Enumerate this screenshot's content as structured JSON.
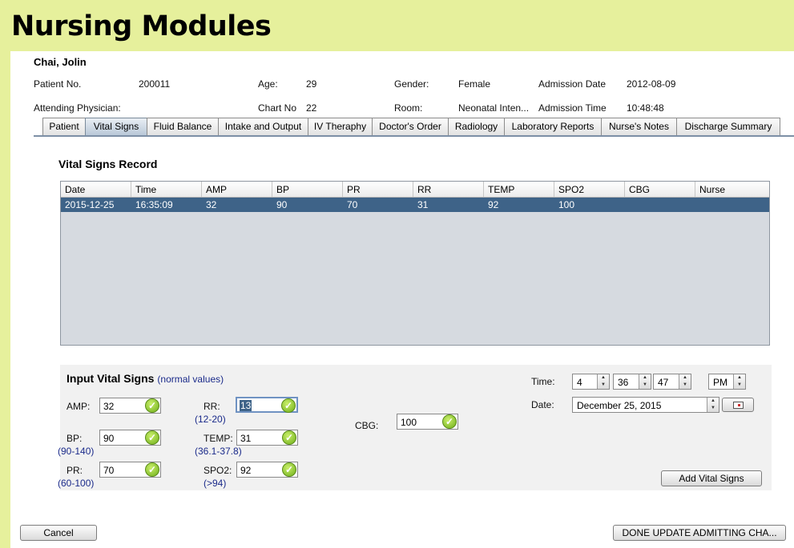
{
  "app_title": "Nursing Modules",
  "patient": {
    "name": "Chai, Jolin",
    "fields": {
      "patient_no_label": "Patient No.",
      "patient_no": "200011",
      "age_label": "Age:",
      "age": "29",
      "gender_label": "Gender:",
      "gender": "Female",
      "admission_date_label": "Admission Date",
      "admission_date": "2012-08-09",
      "physician_label": "Attending Physician:",
      "physician": "",
      "chart_no_label": "Chart No",
      "chart_no": "22",
      "room_label": "Room:",
      "room": "Neonatal Inten...",
      "admission_time_label": "Admission Time",
      "admission_time": "10:48:48"
    }
  },
  "tabs": [
    "Patient",
    "Vital Signs",
    "Fluid Balance",
    "Intake and Output",
    "IV Theraphy",
    "Doctor's Order",
    "Radiology",
    "Laboratory Reports",
    "Nurse's Notes",
    "Discharge Summary"
  ],
  "active_tab": "Vital Signs",
  "record": {
    "title": "Vital Signs Record",
    "columns": [
      "Date",
      "Time",
      "AMP",
      "BP",
      "PR",
      "RR",
      "TEMP",
      "SPO2",
      "CBG",
      "Nurse"
    ],
    "rows": [
      [
        "2015-12-25",
        "16:35:09",
        "32",
        "90",
        "70",
        "31",
        "92",
        "100",
        "",
        ""
      ]
    ]
  },
  "input": {
    "title": "Input Vital Signs",
    "normal_values": "(normal values)",
    "amp": {
      "label": "AMP:",
      "value": "32"
    },
    "bp": {
      "label": "BP:",
      "value": "90",
      "range": "(90-140)"
    },
    "pr": {
      "label": "PR:",
      "value": "70",
      "range": "(60-100)"
    },
    "rr": {
      "label": "RR:",
      "value": "13",
      "range": "(12-20)"
    },
    "temp": {
      "label": "TEMP:",
      "value": "31",
      "range": "(36.1-37.8)"
    },
    "spo2": {
      "label": "SPO2:",
      "value": "92",
      "range": "(>94)"
    },
    "cbg": {
      "label": "CBG:",
      "value": "100"
    },
    "time_label": "Time:",
    "hour": "4",
    "minute": "36",
    "second": "47",
    "ampm": "PM",
    "date_label": "Date:",
    "date": "December 25, 2015",
    "add_button": "Add Vital Signs"
  },
  "footer": {
    "cancel": "Cancel",
    "done": "DONE UPDATE ADMITTING CHA..."
  },
  "colors": {
    "background": "#e6f09c",
    "selected_row": "#3e6388",
    "range_text": "#1a2a8a",
    "ok_icon": "#7cbc1f"
  }
}
